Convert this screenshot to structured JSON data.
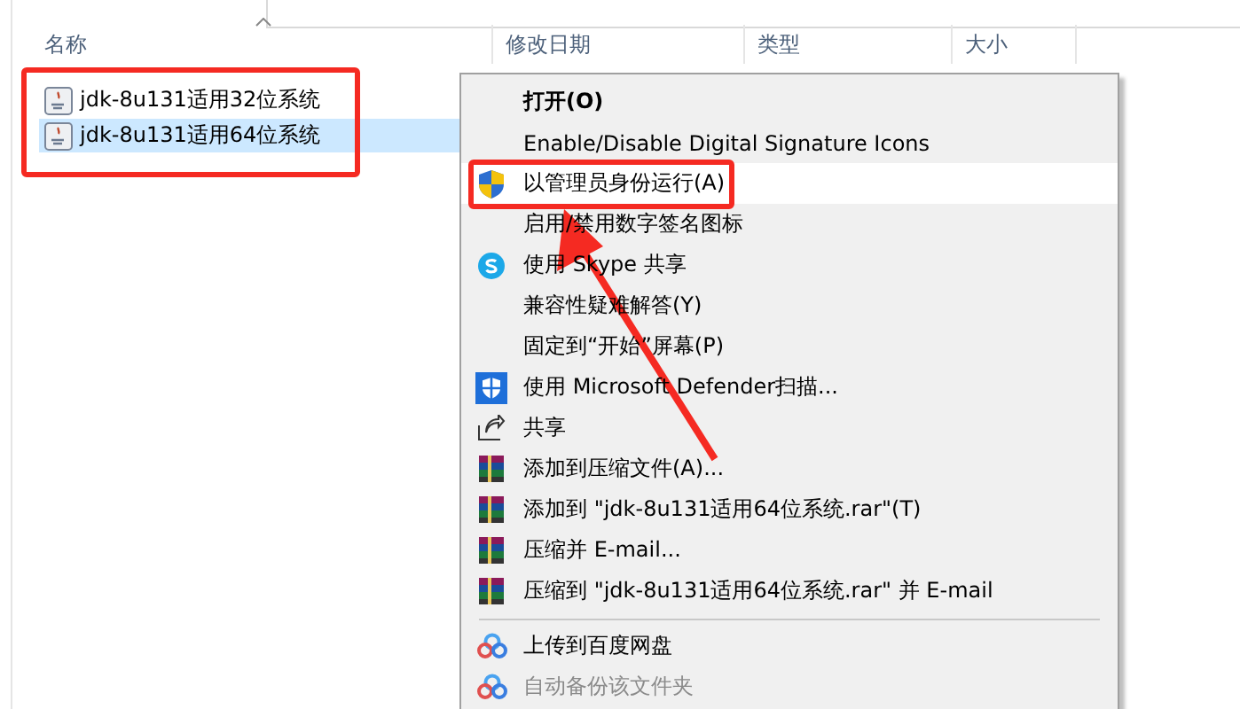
{
  "columns": [
    {
      "label": "名称"
    },
    {
      "label": "修改日期"
    },
    {
      "label": "类型"
    },
    {
      "label": "大小"
    }
  ],
  "files": [
    {
      "name": "jdk-8u131适用32位系统",
      "selected": false
    },
    {
      "name": "jdk-8u131适用64位系统",
      "selected": true
    }
  ],
  "context_menu": [
    {
      "label": "打开(O)",
      "kind": "default",
      "highlighted": false,
      "disabled": false
    },
    {
      "label": "Enable/Disable Digital Signature Icons",
      "kind": "plain",
      "highlighted": false,
      "disabled": false
    },
    {
      "label": "以管理员身份运行(A)",
      "kind": "admin",
      "highlighted": true,
      "disabled": false
    },
    {
      "label": "启用/禁用数字签名图标",
      "kind": "plain",
      "highlighted": false,
      "disabled": false
    },
    {
      "label": "使用 Skype 共享",
      "kind": "skype",
      "highlighted": false,
      "disabled": false
    },
    {
      "label": "兼容性疑难解答(Y)",
      "kind": "plain",
      "highlighted": false,
      "disabled": false
    },
    {
      "label": "固定到“开始”屏幕(P)",
      "kind": "plain",
      "highlighted": false,
      "disabled": false
    },
    {
      "label": "使用 Microsoft Defender扫描...",
      "kind": "defender",
      "highlighted": false,
      "disabled": false
    },
    {
      "label": "共享",
      "kind": "share",
      "highlighted": false,
      "disabled": false
    },
    {
      "label": "添加到压缩文件(A)...",
      "kind": "archive",
      "highlighted": false,
      "disabled": false
    },
    {
      "label": "添加到 \"jdk-8u131适用64位系统.rar\"(T)",
      "kind": "archive",
      "highlighted": false,
      "disabled": false
    },
    {
      "label": "压缩并 E-mail...",
      "kind": "archive",
      "highlighted": false,
      "disabled": false
    },
    {
      "label": "压缩到 \"jdk-8u131适用64位系统.rar\" 并 E-mail",
      "kind": "archive",
      "highlighted": false,
      "disabled": false
    },
    {
      "kind": "separator"
    },
    {
      "label": "上传到百度网盘",
      "kind": "cloud",
      "highlighted": false,
      "disabled": false
    },
    {
      "label": "自动备份该文件夹",
      "kind": "cloud",
      "highlighted": false,
      "disabled": true
    }
  ]
}
